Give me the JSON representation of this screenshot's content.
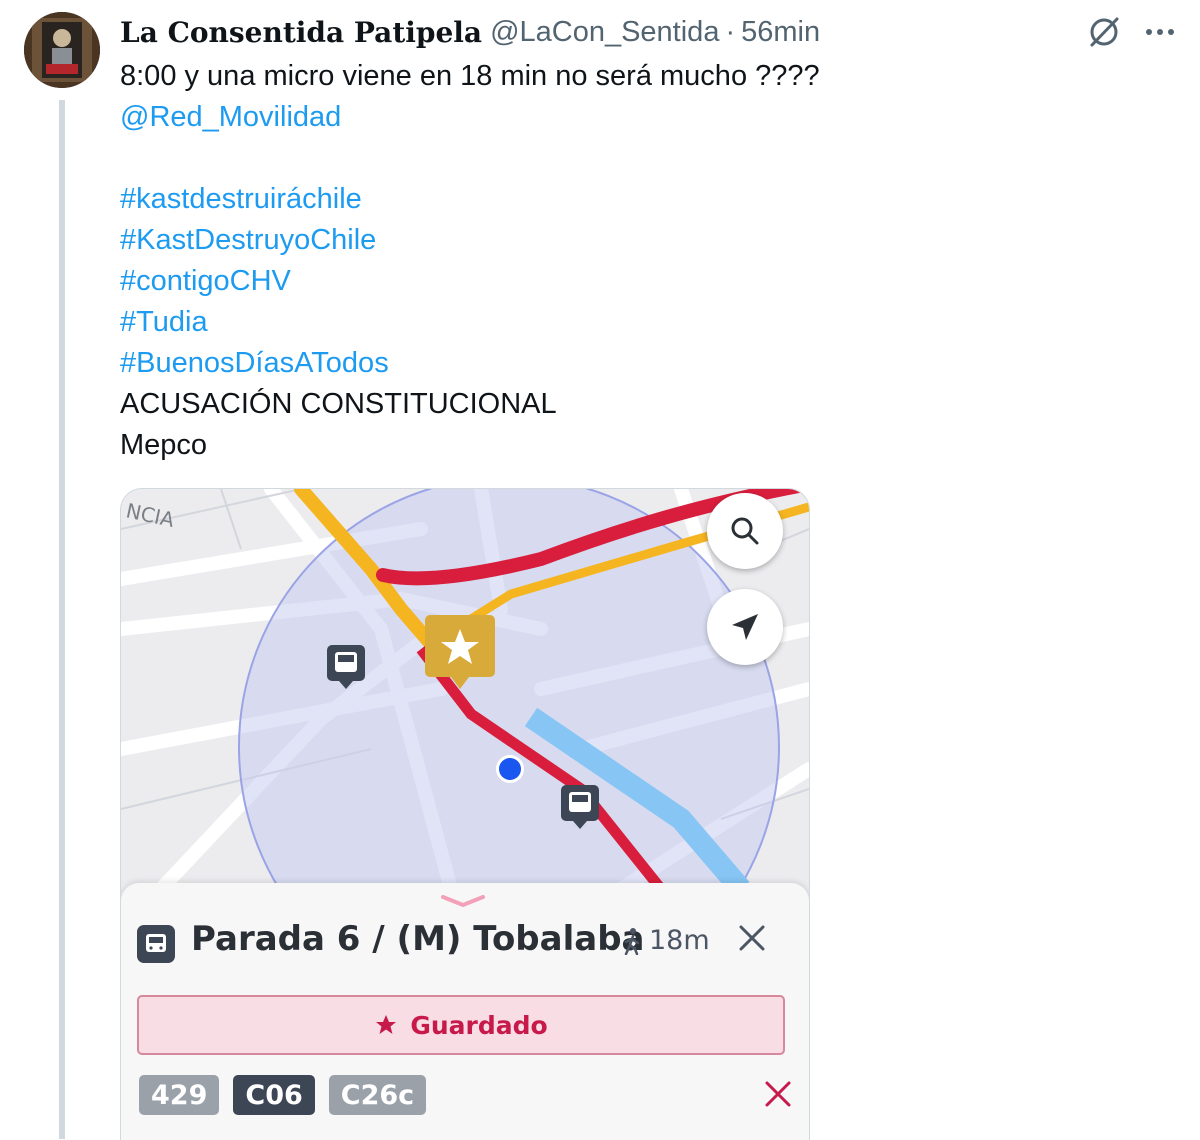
{
  "tweet": {
    "display_name": "La Consentida Patipela",
    "handle": "@LaCon_Sentida",
    "separator": "·",
    "time": "56min",
    "lines": [
      {
        "text": "8:00 y una micro viene en 18 min no será mucho ????",
        "kind": "text"
      },
      {
        "text": "@Red_Movilidad",
        "kind": "link"
      },
      {
        "text": "",
        "kind": "blank"
      },
      {
        "text": "#kastdestruiráchile",
        "kind": "link"
      },
      {
        "text": "#KastDestruyoChile",
        "kind": "link"
      },
      {
        "text": "#contigoCHV",
        "kind": "link"
      },
      {
        "text": "#Tudia",
        "kind": "link"
      },
      {
        "text": "#BuenosDíasATodos",
        "kind": "link"
      },
      {
        "text": "ACUSACIÓN CONSTITUCIONAL",
        "kind": "text"
      },
      {
        "text": "Mepco",
        "kind": "text"
      }
    ]
  },
  "media": {
    "map_street_label": "NCIA",
    "stop_name": "Parada 6 / (M) Tobalaba",
    "walk_time": "18m",
    "saved_label": "Guardado",
    "routes": [
      {
        "label": "429",
        "style": "gray"
      },
      {
        "label": "C06",
        "style": "dark"
      },
      {
        "label": "C26c",
        "style": "gray"
      }
    ],
    "icons": [
      "search-icon",
      "navigation-arrow-icon",
      "star-icon",
      "bus-icon",
      "walk-icon",
      "close-icon",
      "chevron-down-icon"
    ]
  },
  "colors": {
    "link": "#1d9bf0",
    "accent_red": "#d81e3c",
    "accent_yellow": "#f5b520",
    "saved_pink": "#c8194b",
    "marker_gold": "#d8aa3a"
  }
}
